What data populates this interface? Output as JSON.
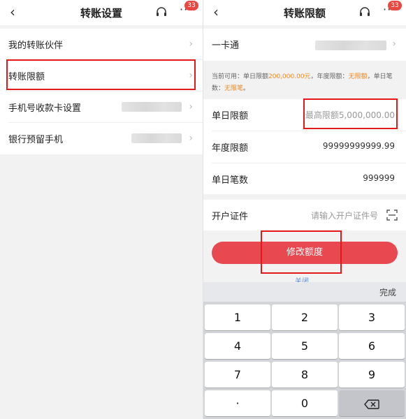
{
  "left": {
    "title": "转账设置",
    "badge": "33",
    "menu": [
      {
        "label": "我的转账伙伴"
      },
      {
        "label": "转账限额"
      },
      {
        "label": "手机号收款卡设置"
      },
      {
        "label": "银行预留手机"
      }
    ]
  },
  "right": {
    "title": "转账限额",
    "badge": "33",
    "card_label": "一卡通",
    "note": {
      "prefix": "当前可用：单日限额",
      "daily": "200,000.00元",
      "mid1": "，年度限额：",
      "yearly": "无限额",
      "mid2": "，单日笔数：",
      "count": "无限笔",
      "suffix": "。"
    },
    "fields": [
      {
        "label": "单日限额",
        "value": "最高限额5,000,000.00"
      },
      {
        "label": "年度限额",
        "value": "99999999999.99"
      },
      {
        "label": "单日笔数",
        "value": "999999"
      }
    ],
    "id_label": "开户证件",
    "id_placeholder": "请输入开户证件号",
    "submit_label": "修改额度",
    "close_label": "关闭",
    "keyboard": {
      "done": "完成",
      "keys": [
        "1",
        "2",
        "3",
        "4",
        "5",
        "6",
        "7",
        "8",
        "9",
        "·",
        "0"
      ]
    }
  },
  "colors": {
    "accent": "#e8484f",
    "highlight": "#e31919",
    "orange": "#f08a25"
  }
}
